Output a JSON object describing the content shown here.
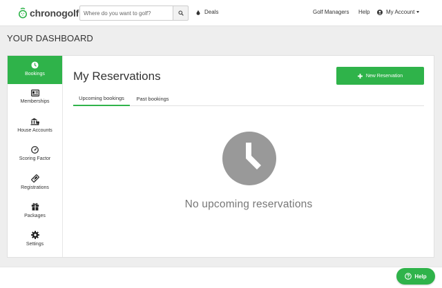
{
  "header": {
    "brand": "chronogolf",
    "search": {
      "placeholder": "Where do you want to golf?",
      "value": ""
    },
    "deals_label": "Deals",
    "golf_managers_label": "Golf Managers",
    "help_label": "Help",
    "account_label": "My Account"
  },
  "dashboard_title": "YOUR DASHBOARD",
  "sidebar": {
    "items": [
      {
        "label": "Bookings",
        "icon": "clock-icon",
        "active": true
      },
      {
        "label": "Memberships",
        "icon": "id-card-icon",
        "active": false
      },
      {
        "label": "House Accounts",
        "icon": "bank-icon",
        "active": false
      },
      {
        "label": "Scoring Factor",
        "icon": "gauge-icon",
        "active": false
      },
      {
        "label": "Registrations",
        "icon": "ticket-icon",
        "active": false
      },
      {
        "label": "Packages",
        "icon": "gift-icon",
        "active": false
      },
      {
        "label": "Settings",
        "icon": "gear-icon",
        "active": false
      }
    ]
  },
  "main": {
    "title": "My Reservations",
    "new_button_label": "New Reservation",
    "tabs": [
      {
        "label": "Upcoming bookings",
        "active": true
      },
      {
        "label": "Past bookings",
        "active": false
      }
    ],
    "empty_message": "No upcoming reservations"
  },
  "help_button_label": "Help",
  "colors": {
    "accent": "#2fb34a",
    "empty_icon": "#999999"
  }
}
